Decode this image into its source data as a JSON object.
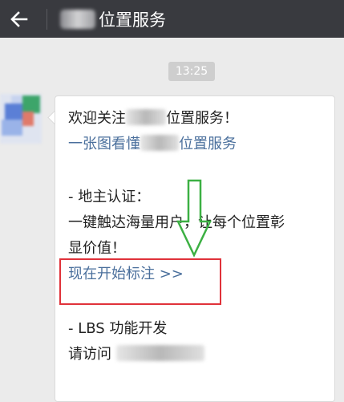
{
  "header": {
    "back_icon": "arrow-left-icon",
    "title": "位置服务"
  },
  "chat": {
    "time": "13:25",
    "message": {
      "line1": "欢迎关注",
      "line1_suffix": "位置服务！",
      "link1_prefix": "一张图看懂",
      "link1_suffix": "位置服务",
      "section1_title": "- 地主认证：",
      "section1_body1": "一键触达海量用户，让每个位置彰",
      "section1_body2": "显价值！",
      "cta_link": "现在开始标注 >>",
      "section2_title": "- LBS 功能开发",
      "section2_body_prefix": "请访问"
    }
  },
  "annotations": {
    "highlight_color": "#e0323a",
    "arrow_color": "#3cb043",
    "arrow_icon": "arrow-down-icon"
  },
  "theme": {
    "header_bg": "#393a3f",
    "chat_bg": "#ebebeb",
    "link_color": "#4a6f9c"
  }
}
